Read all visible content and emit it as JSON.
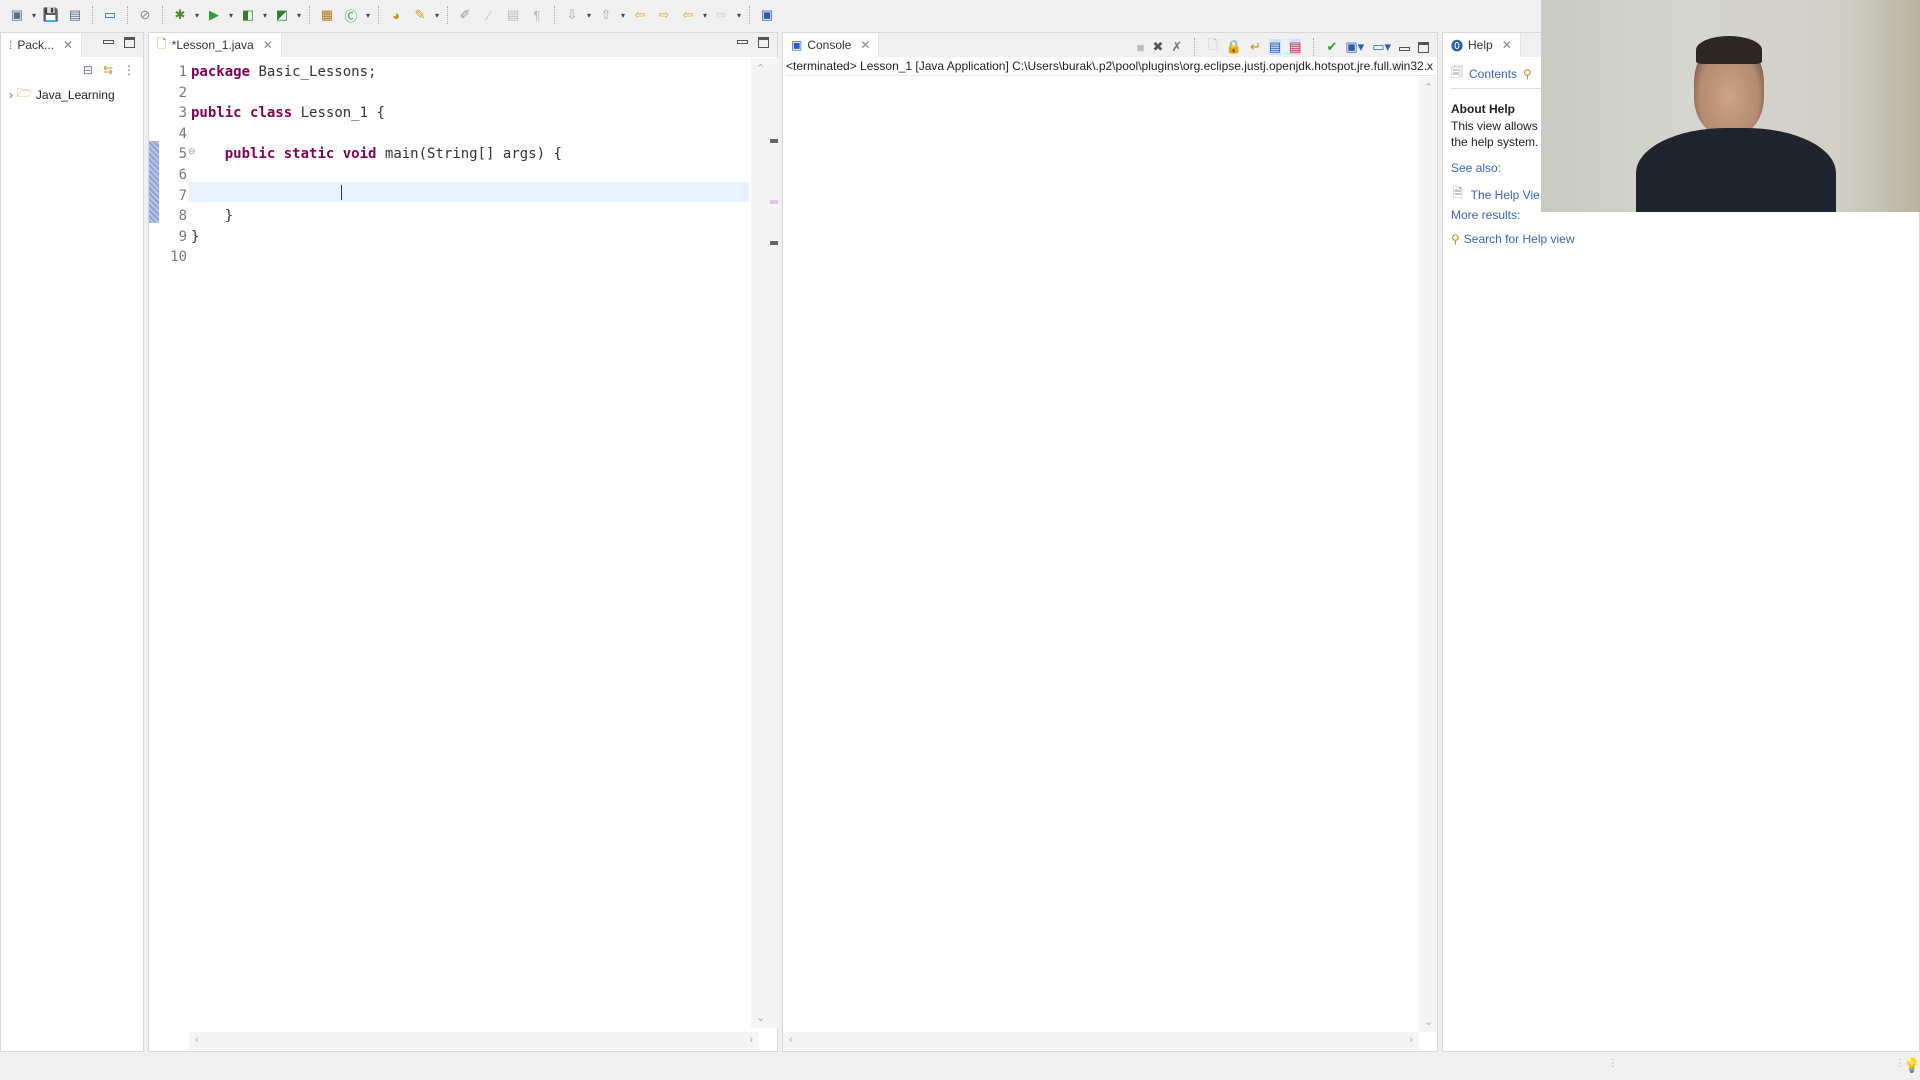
{
  "toolbar": {
    "icons": [
      "new-icon",
      "save-icon",
      "save-all-icon",
      "open-console-icon",
      "skip-breakpoints-icon",
      "debug-icon",
      "run-icon",
      "coverage-icon",
      "external-tools-icon",
      "new-java-project-icon",
      "new-class-icon",
      "open-type-icon",
      "search-icon",
      "toggle-mark-occurrences-icon",
      "toggle-edit-block-icon",
      "toggle-word-wrap-icon",
      "show-whitespace-icon",
      "next-annotation-icon",
      "previous-annotation-icon",
      "last-edit-location-icon",
      "back-icon",
      "forward-icon",
      "open-perspective-icon"
    ]
  },
  "package_explorer": {
    "tab_label": "Pack...",
    "tree": [
      {
        "label": "Java_Learning",
        "expanded": false
      }
    ]
  },
  "editor": {
    "tab_label": "*Lesson_1.java",
    "lines": [
      {
        "num": "1",
        "tokens": [
          {
            "k": "kw",
            "t": "package"
          },
          {
            "k": "txt",
            "t": " Basic_Lessons;"
          }
        ]
      },
      {
        "num": "2",
        "tokens": []
      },
      {
        "num": "3",
        "tokens": [
          {
            "k": "kw",
            "t": "public"
          },
          {
            "k": "txt",
            "t": " "
          },
          {
            "k": "kw",
            "t": "class"
          },
          {
            "k": "txt",
            "t": " Lesson_1 {"
          }
        ]
      },
      {
        "num": "4",
        "tokens": []
      },
      {
        "num": "5",
        "tokens": [
          {
            "k": "txt",
            "t": "    "
          },
          {
            "k": "kw",
            "t": "public"
          },
          {
            "k": "txt",
            "t": " "
          },
          {
            "k": "kw",
            "t": "static"
          },
          {
            "k": "txt",
            "t": " "
          },
          {
            "k": "kw",
            "t": "void"
          },
          {
            "k": "txt",
            "t": " main(String[] args) {"
          }
        ]
      },
      {
        "num": "6",
        "tokens": []
      },
      {
        "num": "7",
        "tokens": []
      },
      {
        "num": "8",
        "tokens": [
          {
            "k": "txt",
            "t": "    }"
          }
        ]
      },
      {
        "num": "9",
        "tokens": [
          {
            "k": "txt",
            "t": "}"
          }
        ]
      },
      {
        "num": "10",
        "tokens": []
      }
    ],
    "current_line": 7
  },
  "console": {
    "tab_label": "Console",
    "status": "<terminated> Lesson_1 [Java Application] C:\\Users\\burak\\.p2\\pool\\plugins\\org.eclipse.justj.openjdk.hotspot.jre.full.win32.x"
  },
  "help": {
    "tab_label": "Help",
    "contents_label": "Contents",
    "about_title": "About Help",
    "about_text": "This view allows t",
    "about_text2": "the help system.",
    "see_also": "See also:",
    "help_view_link": "The Help Vie",
    "more_results": "More results:",
    "search_link": "Search for Help view"
  },
  "webcam": {
    "description": "presenter webcam overlay"
  }
}
